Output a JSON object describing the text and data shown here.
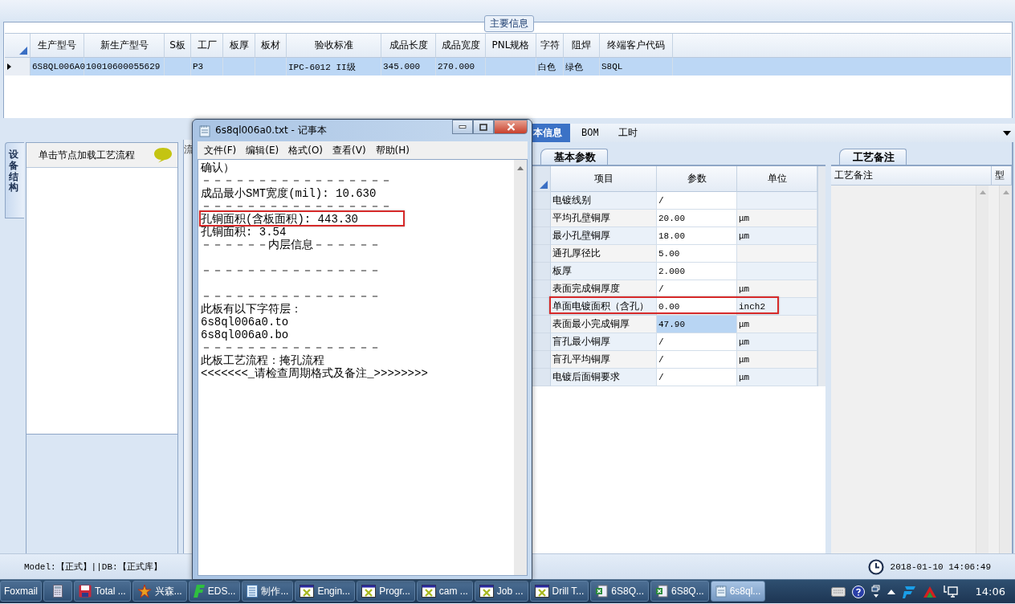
{
  "main_info": {
    "title": "主要信息",
    "columns": [
      "生产型号",
      "新生产型号",
      "S板",
      "工厂",
      "板厚",
      "板材",
      "验收标准",
      "成品长度",
      "成品宽度",
      "PNL规格",
      "字符",
      "阻焊",
      "终端客户代码"
    ],
    "rows": [
      {
        "selected": true,
        "cells": [
          {
            "text": "6S8QL006A0"
          },
          {
            "text": "10010600055629"
          },
          {},
          {
            "text": "P3"
          },
          {},
          {},
          {
            "text": "IPC-6012 II级"
          },
          {
            "text": "345.000"
          },
          {
            "text": "270.000"
          },
          {},
          {
            "text": "白色"
          },
          {
            "text": "绿色"
          },
          {
            "text": "S8QL"
          }
        ]
      }
    ]
  },
  "left_pane": {
    "vertical_tab": "设备结构",
    "header": "单击节点加载工艺流程",
    "side_tab": "流"
  },
  "detail_tabs": [
    {
      "label": "本信息",
      "selected": true
    },
    {
      "label": "BOM",
      "selected": false
    },
    {
      "label": "工时",
      "selected": false
    }
  ],
  "params": {
    "tab": "基本参数",
    "columns": [
      "项目",
      "参数",
      "单位"
    ],
    "rows": [
      {
        "item": "电镀线别",
        "value": "/",
        "value_selected": false,
        "highlighted": false
      },
      {
        "item": "平均孔壁铜厚",
        "value": "20.00",
        "unit": "μm",
        "value_selected": false,
        "highlighted": false
      },
      {
        "item": "最小孔壁铜厚",
        "value": "18.00",
        "unit": "μm",
        "value_selected": false,
        "highlighted": false
      },
      {
        "item": "通孔厚径比",
        "value": "5.00",
        "value_selected": false,
        "highlighted": false
      },
      {
        "item": "板厚",
        "value": "2.000",
        "value_selected": false,
        "highlighted": false
      },
      {
        "item": "表面完成铜厚度",
        "value": "/",
        "unit": "μm",
        "value_selected": false,
        "highlighted": false
      },
      {
        "item": "单面电镀面积（含孔）",
        "value": "0.00",
        "unit": "inch2",
        "value_selected": false,
        "highlighted": true
      },
      {
        "item": "表面最小完成铜厚",
        "value": "47.90",
        "unit": "μm",
        "value_selected": true,
        "highlighted": false
      },
      {
        "item": "盲孔最小铜厚",
        "value": "/",
        "unit": "μm",
        "value_selected": false,
        "highlighted": false
      },
      {
        "item": "盲孔平均铜厚",
        "value": "/",
        "unit": "μm",
        "value_selected": false,
        "highlighted": false
      },
      {
        "item": "电镀后面铜要求",
        "value": "/",
        "unit": "μm",
        "value_selected": false,
        "highlighted": false
      }
    ]
  },
  "notes": {
    "tab": "工艺备注",
    "columns": [
      "工艺备注",
      "型"
    ]
  },
  "status_bar": {
    "mode": "Model:【正式】||DB:【正式库】",
    "datetime": "2018-01-10 14:06:49"
  },
  "notepad": {
    "title": "6s8ql006a0.txt - 记事本",
    "menu": [
      "文件(F)",
      "编辑(E)",
      "格式(O)",
      "查看(V)",
      "帮助(H)"
    ],
    "lines": [
      {
        "kind": "text",
        "text": "确认）",
        "highlighted": false
      },
      {
        "kind": "text",
        "text": "－－－－－－－－－－－－－－－－－",
        "highlighted": false
      },
      {
        "kind": "text",
        "text": "成品最小SMT宽度(mil): 10.630",
        "highlighted": false
      },
      {
        "kind": "text",
        "text": "－－－－－－－－－－－－－－－－－",
        "highlighted": false
      },
      {
        "kind": "text",
        "text": "孔铜面积(含板面积): 443.30",
        "highlighted": true
      },
      {
        "kind": "text",
        "text": "孔铜面积: 3.54",
        "highlighted": false
      },
      {
        "kind": "text",
        "text": "－－－－－－内层信息－－－－－－",
        "highlighted": false
      },
      {
        "kind": "blank"
      },
      {
        "kind": "text",
        "text": "－－－－－－－－－－－－－－－－",
        "highlighted": false
      },
      {
        "kind": "blank"
      },
      {
        "kind": "text",
        "text": "－－－－－－－－－－－－－－－－",
        "highlighted": false
      },
      {
        "kind": "text",
        "text": "此板有以下字符层：",
        "highlighted": false
      },
      {
        "kind": "text",
        "text": "6s8ql006a0.to",
        "highlighted": false
      },
      {
        "kind": "text",
        "text": "6s8ql006a0.bo",
        "highlighted": false
      },
      {
        "kind": "text",
        "text": "－－－－－－－－－－－－－－－－",
        "highlighted": false
      },
      {
        "kind": "text",
        "text": "此板工艺流程：掩孔流程",
        "highlighted": false
      },
      {
        "kind": "text",
        "text": "<<<<<<<_请检查周期格式及备注_>>>>>>>>",
        "highlighted": false
      }
    ]
  },
  "taskbar": {
    "items": [
      {
        "kind": "plain",
        "label": "Foxmail",
        "active": false
      },
      {
        "kind": "calculator",
        "active": false
      },
      {
        "kind": "floppy",
        "label": "Total ...",
        "active": false
      },
      {
        "kind": "star",
        "label": "兴森...",
        "active": false
      },
      {
        "kind": "app",
        "label": "EDS...",
        "active": false
      },
      {
        "kind": "list",
        "label": "制作...",
        "active": false
      },
      {
        "kind": "window",
        "label": "Engin...",
        "active": false
      },
      {
        "kind": "window",
        "label": "Progr...",
        "active": false
      },
      {
        "kind": "window",
        "label": "cam ...",
        "active": false
      },
      {
        "kind": "window",
        "label": "Job ...",
        "active": false
      },
      {
        "kind": "window",
        "label": "Drill T...",
        "active": false
      },
      {
        "kind": "spreadsheet",
        "label": "6S8Q...",
        "active": false
      },
      {
        "kind": "spreadsheet",
        "label": "6S8Q...",
        "active": false
      },
      {
        "kind": "notepad",
        "label": "6s8ql...",
        "active": true
      }
    ],
    "clock": "14:06"
  }
}
